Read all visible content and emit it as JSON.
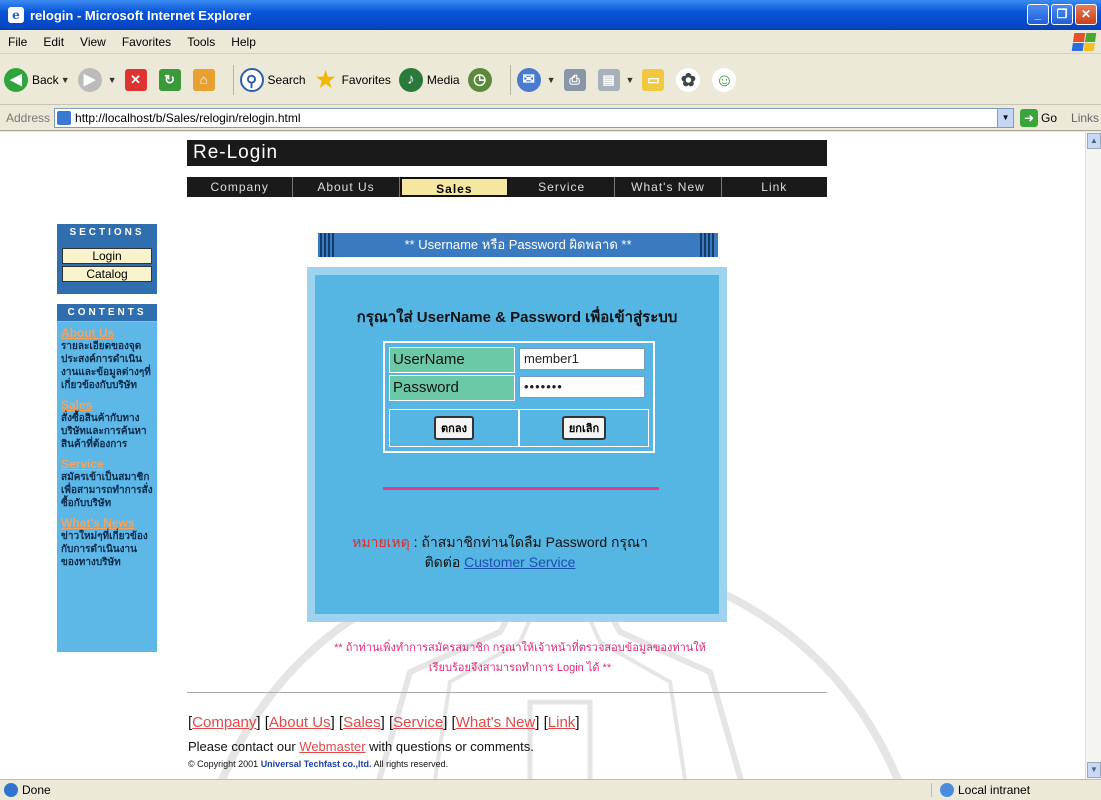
{
  "window": {
    "title": "relogin - Microsoft Internet Explorer",
    "icons": {
      "app": "ie-icon",
      "minimize": "minimize-icon",
      "maximize": "maximize-icon",
      "close": "close-icon"
    }
  },
  "menu": [
    "File",
    "Edit",
    "View",
    "Favorites",
    "Tools",
    "Help"
  ],
  "toolbar": {
    "back_label": "Back",
    "search_label": "Search",
    "favorites_label": "Favorites",
    "media_label": "Media"
  },
  "address": {
    "label": "Address",
    "url": "http://localhost/b/Sales/relogin/relogin.html",
    "go_label": "Go",
    "links_label": "Links"
  },
  "page": {
    "header_title": "Re-Login",
    "nav": [
      "Company",
      "About Us",
      "Sales",
      "Service",
      "What's New",
      "Link"
    ],
    "nav_active": "Sales",
    "sections_title": "SECTIONS",
    "sections": [
      "Login",
      "Catalog"
    ],
    "contents_title": "CONTENTS",
    "contents": [
      {
        "link": "About Us",
        "desc": "รายละเอียดของจุดประสงค์การดำเนินงานและข้อมูลต่างๆที่เกี่ยวข้องกับบริษัท"
      },
      {
        "link": "Sales",
        "desc": "สั่งซื้อสินค้ากับทางบริษัทและการค้นหาสินค้าที่ต้องการ"
      },
      {
        "link": "Service",
        "desc": "สมัครเข้าเป็นสมาชิกเพื่อสามารถทำการสั่งซื้อกับบริษัท"
      },
      {
        "link": "What's News",
        "desc": "ข่าวใหม่ๆที่เกี่ยวข้องกับการดำเนินงานของทางบริษัท"
      }
    ],
    "error_banner": "** Username หรือ Password ผิดพลาด **",
    "login_prompt": "กรุณาใส่ UserName & Password เพื่อเข้าสู่ระบบ",
    "username_label": "UserName",
    "username_value": "member1",
    "password_label": "Password",
    "password_value": "•••••••",
    "ok_button": "ตกลง",
    "cancel_button": "ยกเลิก",
    "remark_prefix": "หมายเหตุ",
    "remark_text": " : ถ้าสมาชิกท่านใดลืม Password กรุณาติดต่อ ",
    "remark_link": "Customer Service",
    "notice": "** ถ้าท่านเพิ่งทำการสมัครสมาชิก กรุณาให้เจ้าหน้าที่ตรวจสอบข้อมูลของท่านให้เรียบร้อยจึงสามารถทำการ Login ได้ **",
    "footer_links": [
      "Company",
      "About Us",
      "Sales",
      "Service",
      "What's New",
      "Link"
    ],
    "contact_prefix": "Please contact our ",
    "contact_link": "Webmaster",
    "contact_suffix": " with questions or comments.",
    "copyright_prefix": "© Copyright 2001 ",
    "copyright_company": "Universal Techfast co.,ltd.",
    "copyright_suffix": " All rights reserved."
  },
  "status": {
    "left": "Done",
    "zone": "Local intranet"
  },
  "colors": {
    "titlebar": "#0a55d8",
    "nav_bg": "#1a1a1a",
    "sidebar_blue": "#2f6fb0",
    "panel_blue": "#55b6e3",
    "label_green": "#6cc9a8",
    "accent_pink": "#e03c8c"
  }
}
